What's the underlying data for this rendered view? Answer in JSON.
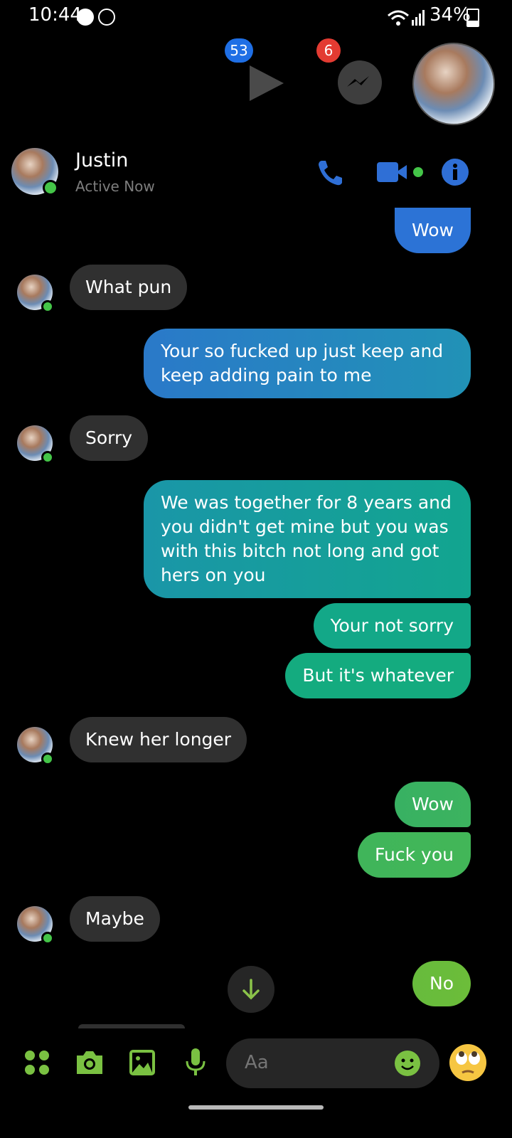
{
  "status_bar": {
    "time": "10:44",
    "battery": "34%",
    "battery_level": 0.34
  },
  "chat_heads": {
    "video_badge": "53",
    "messenger_badge": "6"
  },
  "header": {
    "name": "Justin",
    "status": "Active Now"
  },
  "messages": [
    {
      "side": "out",
      "text": "Wow"
    },
    {
      "side": "in",
      "text": "What pun"
    },
    {
      "side": "out",
      "text": "Your so fucked up just keep and keep adding pain to me"
    },
    {
      "side": "in",
      "text": "Sorry"
    },
    {
      "side": "out",
      "text": "We was together for 8 years and you didn't get mine but you was with this bitch not long and got hers on you"
    },
    {
      "side": "out",
      "text": "Your not sorry"
    },
    {
      "side": "out",
      "text": "But it's whatever"
    },
    {
      "side": "in",
      "text": "Knew her longer"
    },
    {
      "side": "out",
      "text": "Wow"
    },
    {
      "side": "out",
      "text": "Fuck you"
    },
    {
      "side": "in",
      "text": "Maybe"
    },
    {
      "side": "out",
      "text": "No"
    }
  ],
  "composer": {
    "placeholder": "Aa"
  },
  "colors": {
    "accent_blue": "#2f6fd6",
    "online_green": "#44c548",
    "toolbar_green": "#7ac142"
  }
}
